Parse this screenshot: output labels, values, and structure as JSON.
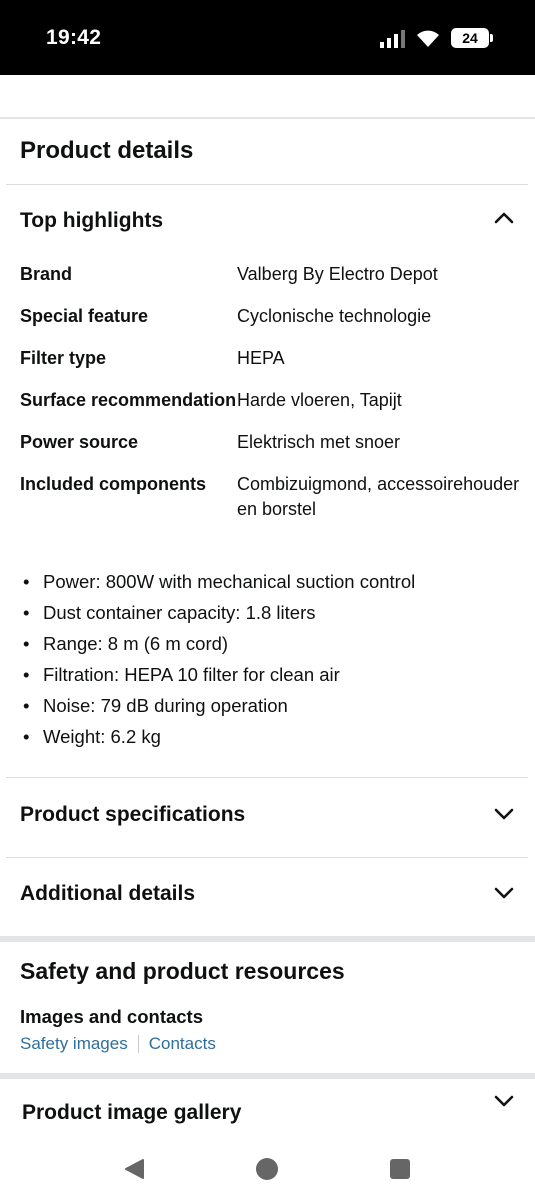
{
  "status_bar": {
    "time": "19:42",
    "battery": "24",
    "icons": [
      "signal-icon",
      "wifi-icon",
      "battery-icon"
    ]
  },
  "product_details": {
    "title": "Product details",
    "top_highlights": {
      "title": "Top highlights",
      "expanded": true,
      "rows": [
        {
          "key": "Brand",
          "value": "Valberg By Electro Depot"
        },
        {
          "key": "Special feature",
          "value": "Cyclonische technologie"
        },
        {
          "key": "Filter type",
          "value": "HEPA"
        },
        {
          "key": "Surface recommendation",
          "value": "Harde vloeren, Tapijt"
        },
        {
          "key": "Power source",
          "value": "Elektrisch met snoer"
        },
        {
          "key": "Included components",
          "value": "Combizuigmond, accessoirehouder en borstel"
        }
      ],
      "bullets": [
        "Power: 800W with mechanical suction control",
        "Dust container capacity: 1.8 liters",
        "Range: 8 m (6 m cord)",
        "Filtration: HEPA 10 filter for clean air",
        "Noise: 79 dB during operation",
        "Weight: 6.2 kg"
      ]
    },
    "product_specifications": {
      "title": "Product specifications",
      "expanded": false
    },
    "additional_details": {
      "title": "Additional details",
      "expanded": false
    }
  },
  "safety": {
    "title": "Safety and product resources",
    "subheading": "Images and contacts",
    "links": [
      "Safety images",
      "Contacts"
    ],
    "link_color": "#2f6e9c"
  },
  "gallery": {
    "title": "Product image gallery",
    "expanded": false
  },
  "nav": {
    "icons": [
      "back-icon",
      "home-icon",
      "recents-icon"
    ]
  }
}
